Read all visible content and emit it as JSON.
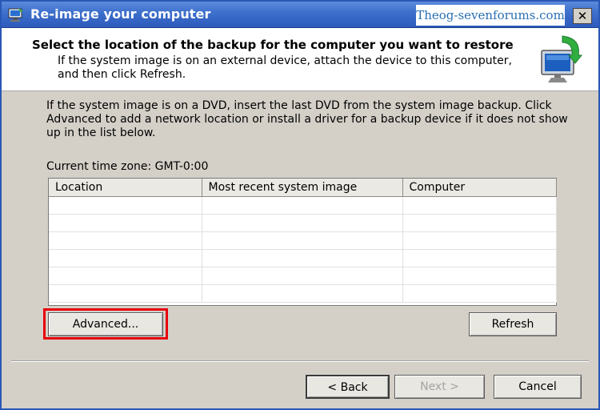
{
  "window": {
    "title": "Re-image your computer",
    "watermark": "Theog-sevenforums.com",
    "close_glyph": "✕"
  },
  "header": {
    "title": "Select the location of the backup for the computer you want to restore",
    "description": "If the system image is on an external device, attach the device to this computer, and then click Refresh.",
    "icon": "computer-restore-icon"
  },
  "body": {
    "instructions": "If the system image is on a DVD, insert the last DVD from the system image backup. Click Advanced to add a network location or install a driver for a backup device if it does not show up in the list below.",
    "timezone": "Current time zone: GMT-0:00"
  },
  "table": {
    "columns": [
      "Location",
      "Most recent system image",
      "Computer"
    ],
    "rows": []
  },
  "buttons": {
    "advanced": "Advanced...",
    "refresh": "Refresh",
    "back": "< Back",
    "next": "Next >",
    "cancel": "Cancel"
  },
  "colors": {
    "titlebar": "#3c6ecb",
    "highlight": "#e8000b",
    "dialog_bg": "#d4d0c8"
  }
}
